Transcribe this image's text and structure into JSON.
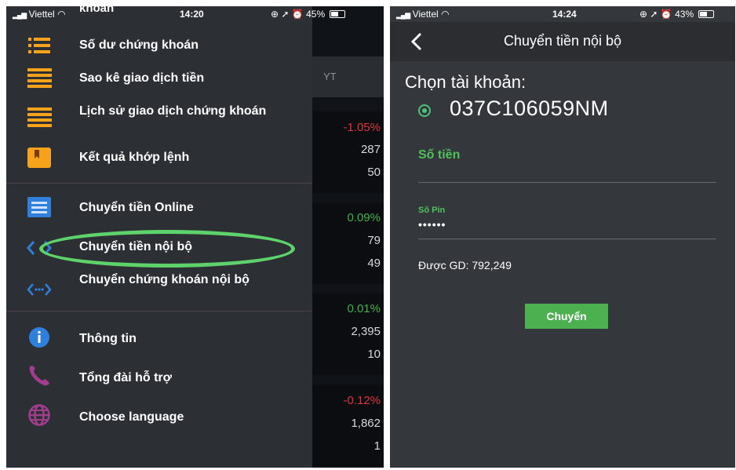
{
  "left_screen": {
    "status": {
      "carrier": "Viettel",
      "time": "14:20",
      "battery": "45%"
    },
    "background_app": {
      "header_label": "YT",
      "cards": [
        {
          "change": "-1.05%",
          "change_color": "#d9363e",
          "value1": "287",
          "value2": "50"
        },
        {
          "change": "0.09%",
          "change_color": "#3cb54a",
          "value1": "79",
          "value2": "49"
        },
        {
          "change": "0.01%",
          "change_color": "#3cb54a",
          "value1": "2,395",
          "value2": "10"
        },
        {
          "change": "-0.12%",
          "change_color": "#d9363e",
          "value1": "1,862",
          "value2": "1"
        }
      ]
    },
    "menu": {
      "top_partial": "khoản",
      "items": [
        {
          "label": "Số dư chứng khoán",
          "icon": "list-icon"
        },
        {
          "label": "Sao kê giao dịch tiền",
          "icon": "statement-icon"
        },
        {
          "label": "Lịch sử giao dịch chứng khoán",
          "icon": "history-icon"
        },
        {
          "label": "Kết quả khớp lệnh",
          "icon": "bookmark-icon"
        },
        {
          "label": "Chuyển tiền Online",
          "icon": "transfer-online-icon"
        },
        {
          "label": "Chuyển tiền nội bộ",
          "icon": "internal-transfer-icon",
          "highlighted": true
        },
        {
          "label": "Chuyển chứng khoán nội bộ",
          "icon": "stock-transfer-icon"
        },
        {
          "label": "Thông tin",
          "icon": "info-icon"
        },
        {
          "label": "Tổng đài hỗ trợ",
          "icon": "phone-icon"
        },
        {
          "label": "Choose language",
          "icon": "globe-icon"
        }
      ]
    }
  },
  "right_screen": {
    "status": {
      "carrier": "Viettel",
      "time": "14:24",
      "battery": "43%"
    },
    "title": "Chuyển tiền nội bộ",
    "choose_account_label": "Chọn tài khoản:",
    "account_number": "037C106059NM",
    "amount_label": "Số tiền",
    "amount_value": "",
    "pin_label": "Số Pin",
    "pin_value": "••••••",
    "available_label": "Được GD:",
    "available_value": "792,249",
    "submit_label": "Chuyển",
    "accent_color": "#4fc25b"
  }
}
